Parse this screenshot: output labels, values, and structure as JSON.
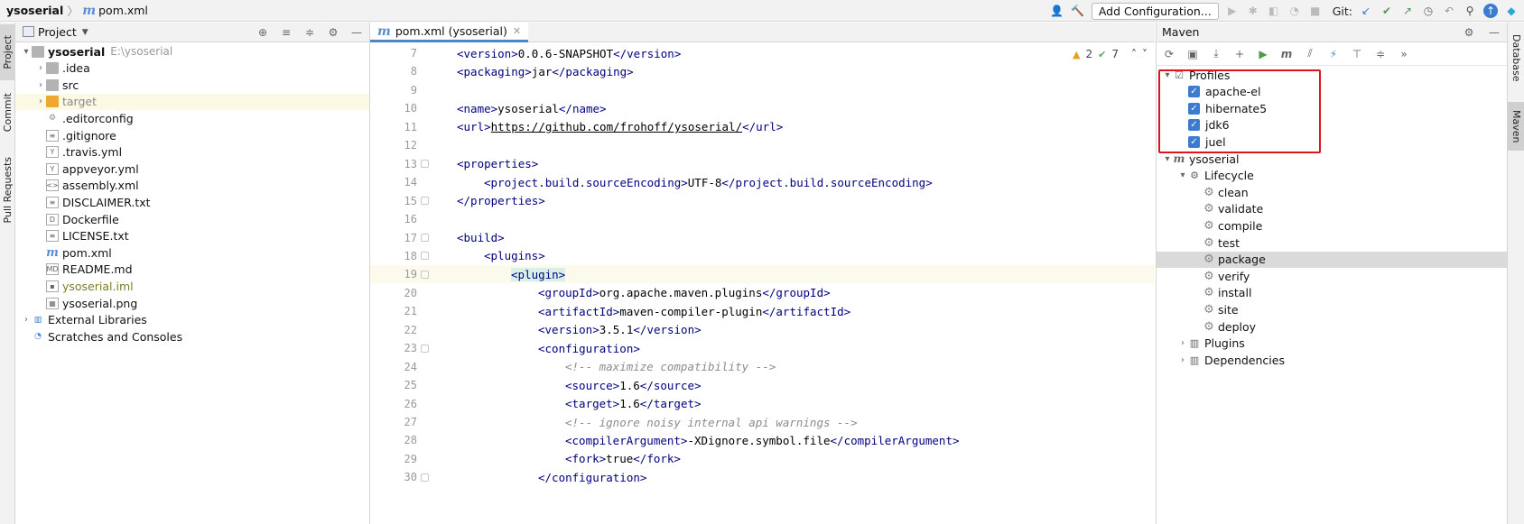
{
  "breadcrumb": {
    "project": "ysoserial",
    "file": "pom.xml"
  },
  "toolbar": {
    "run_config": "Add Configuration...",
    "git_label": "Git:"
  },
  "left_strip": {
    "tabs": [
      "Project",
      "Commit",
      "Pull Requests"
    ]
  },
  "project_panel": {
    "title": "Project",
    "tree": [
      {
        "name": "ysoserial",
        "path": "E:\\ysoserial",
        "icon": "folder-icon",
        "toggle": "▾",
        "depth": 0,
        "bold": true
      },
      {
        "name": ".idea",
        "icon": "folder-icon",
        "toggle": "›",
        "depth": 1
      },
      {
        "name": "src",
        "icon": "folder-icon",
        "toggle": "›",
        "depth": 1
      },
      {
        "name": "target",
        "icon": "folder-orange-icon",
        "toggle": "›",
        "depth": 1,
        "highlight": true
      },
      {
        "name": ".editorconfig",
        "icon": "gear-file-icon",
        "depth": 1
      },
      {
        "name": ".gitignore",
        "icon": "text-file-icon",
        "depth": 1
      },
      {
        "name": ".travis.yml",
        "icon": "yml-file-icon",
        "depth": 1
      },
      {
        "name": "appveyor.yml",
        "icon": "yml-file-icon",
        "depth": 1
      },
      {
        "name": "assembly.xml",
        "icon": "xml-file-icon",
        "depth": 1
      },
      {
        "name": "DISCLAIMER.txt",
        "icon": "text-file-icon",
        "depth": 1
      },
      {
        "name": "Dockerfile",
        "icon": "docker-file-icon",
        "depth": 1
      },
      {
        "name": "LICENSE.txt",
        "icon": "text-file-icon",
        "depth": 1
      },
      {
        "name": "pom.xml",
        "icon": "maven-file-icon",
        "depth": 1
      },
      {
        "name": "README.md",
        "icon": "md-file-icon",
        "depth": 1
      },
      {
        "name": "ysoserial.iml",
        "icon": "iml-file-icon",
        "depth": 1,
        "olive": true
      },
      {
        "name": "ysoserial.png",
        "icon": "image-file-icon",
        "depth": 1
      },
      {
        "name": "External Libraries",
        "icon": "library-icon",
        "toggle": "›",
        "depth": 0
      },
      {
        "name": "Scratches and Consoles",
        "icon": "scratches-icon",
        "depth": 0
      }
    ]
  },
  "editor": {
    "tab": "pom.xml (ysoserial)",
    "warnings": "2",
    "oks": "7",
    "lines": [
      {
        "n": "7",
        "indent": 1,
        "parts": [
          [
            "tag",
            "<version>"
          ],
          [
            "val",
            "0.0.6-SNAPSHOT"
          ],
          [
            "tag",
            "</version>"
          ]
        ]
      },
      {
        "n": "8",
        "indent": 1,
        "parts": [
          [
            "tag",
            "<packaging>"
          ],
          [
            "val",
            "jar"
          ],
          [
            "tag",
            "</packaging>"
          ]
        ]
      },
      {
        "n": "9",
        "indent": 0,
        "parts": []
      },
      {
        "n": "10",
        "indent": 1,
        "parts": [
          [
            "tag",
            "<name>"
          ],
          [
            "val",
            "ysoserial"
          ],
          [
            "tag",
            "</name>"
          ]
        ]
      },
      {
        "n": "11",
        "indent": 1,
        "parts": [
          [
            "tag",
            "<url>"
          ],
          [
            "url",
            "https://github.com/frohoff/ysoserial/"
          ],
          [
            "tag",
            "</url>"
          ]
        ]
      },
      {
        "n": "12",
        "indent": 0,
        "parts": []
      },
      {
        "n": "13",
        "indent": 1,
        "fold": true,
        "parts": [
          [
            "tag",
            "<properties>"
          ]
        ]
      },
      {
        "n": "14",
        "indent": 2,
        "parts": [
          [
            "tag",
            "<project.build.sourceEncoding>"
          ],
          [
            "val",
            "UTF-8"
          ],
          [
            "tag",
            "</project.build.sourceEncoding>"
          ]
        ]
      },
      {
        "n": "15",
        "indent": 1,
        "fold": true,
        "parts": [
          [
            "tag",
            "</properties>"
          ]
        ]
      },
      {
        "n": "16",
        "indent": 0,
        "parts": []
      },
      {
        "n": "17",
        "indent": 1,
        "fold": true,
        "parts": [
          [
            "tag",
            "<build>"
          ]
        ]
      },
      {
        "n": "18",
        "indent": 2,
        "fold": true,
        "parts": [
          [
            "tag",
            "<plugins>"
          ]
        ]
      },
      {
        "n": "19",
        "indent": 3,
        "fold": true,
        "current": true,
        "parts": [
          [
            "taghl",
            "<plugin>"
          ]
        ]
      },
      {
        "n": "20",
        "indent": 4,
        "parts": [
          [
            "tag",
            "<groupId>"
          ],
          [
            "val",
            "org.apache.maven.plugins"
          ],
          [
            "tag",
            "</groupId>"
          ]
        ]
      },
      {
        "n": "21",
        "indent": 4,
        "parts": [
          [
            "tag",
            "<artifactId>"
          ],
          [
            "val",
            "maven-compiler-plugin"
          ],
          [
            "tag",
            "</artifactId>"
          ]
        ]
      },
      {
        "n": "22",
        "indent": 4,
        "parts": [
          [
            "tag",
            "<version>"
          ],
          [
            "val",
            "3.5.1"
          ],
          [
            "tag",
            "</version>"
          ]
        ]
      },
      {
        "n": "23",
        "indent": 4,
        "fold": true,
        "parts": [
          [
            "tag",
            "<configuration>"
          ]
        ]
      },
      {
        "n": "24",
        "indent": 5,
        "parts": [
          [
            "cmt",
            "<!-- maximize compatibility -->"
          ]
        ]
      },
      {
        "n": "25",
        "indent": 5,
        "parts": [
          [
            "tag",
            "<source>"
          ],
          [
            "val",
            "1.6"
          ],
          [
            "tag",
            "</source>"
          ]
        ]
      },
      {
        "n": "26",
        "indent": 5,
        "parts": [
          [
            "tag",
            "<target>"
          ],
          [
            "val",
            "1.6"
          ],
          [
            "tag",
            "</target>"
          ]
        ]
      },
      {
        "n": "27",
        "indent": 5,
        "parts": [
          [
            "cmt",
            "<!-- ignore noisy internal api warnings -->"
          ]
        ]
      },
      {
        "n": "28",
        "indent": 5,
        "parts": [
          [
            "tag",
            "<compilerArgument>"
          ],
          [
            "val",
            "-XDignore.symbol.file"
          ],
          [
            "tag",
            "</compilerArgument>"
          ]
        ]
      },
      {
        "n": "29",
        "indent": 5,
        "parts": [
          [
            "tag",
            "<fork>"
          ],
          [
            "val",
            "true"
          ],
          [
            "tag",
            "</fork>"
          ]
        ]
      },
      {
        "n": "30",
        "indent": 4,
        "fold": true,
        "parts": [
          [
            "tag",
            "</configuration>"
          ]
        ]
      }
    ]
  },
  "maven_panel": {
    "title": "Maven",
    "tree": [
      {
        "label": "Profiles",
        "toggle": "▾",
        "depth": 0,
        "icon": "profiles-icon"
      },
      {
        "label": "apache-el",
        "depth": 1,
        "check": true
      },
      {
        "label": "hibernate5",
        "depth": 1,
        "check": true
      },
      {
        "label": "jdk6",
        "depth": 1,
        "check": true
      },
      {
        "label": "juel",
        "depth": 1,
        "check": true
      },
      {
        "label": "ysoserial",
        "toggle": "▾",
        "depth": 0,
        "icon": "maven-project-icon"
      },
      {
        "label": "Lifecycle",
        "toggle": "▾",
        "depth": 1,
        "icon": "lifecycle-icon"
      },
      {
        "label": "clean",
        "depth": 2,
        "icon": "gear-icon"
      },
      {
        "label": "validate",
        "depth": 2,
        "icon": "gear-icon"
      },
      {
        "label": "compile",
        "depth": 2,
        "icon": "gear-icon"
      },
      {
        "label": "test",
        "depth": 2,
        "icon": "gear-icon"
      },
      {
        "label": "package",
        "depth": 2,
        "icon": "gear-icon",
        "selected": true
      },
      {
        "label": "verify",
        "depth": 2,
        "icon": "gear-icon"
      },
      {
        "label": "install",
        "depth": 2,
        "icon": "gear-icon"
      },
      {
        "label": "site",
        "depth": 2,
        "icon": "gear-icon"
      },
      {
        "label": "deploy",
        "depth": 2,
        "icon": "gear-icon"
      },
      {
        "label": "Plugins",
        "toggle": "›",
        "depth": 1,
        "icon": "plugins-icon"
      },
      {
        "label": "Dependencies",
        "toggle": "›",
        "depth": 1,
        "icon": "dependencies-icon"
      }
    ]
  },
  "right_strip": {
    "tabs": [
      "Database",
      "Maven"
    ]
  },
  "colors": {
    "accent": "#4a88c7",
    "highlight_box": "#e0141e",
    "xml_tag": "#000080",
    "comment": "#8c8c8c"
  }
}
